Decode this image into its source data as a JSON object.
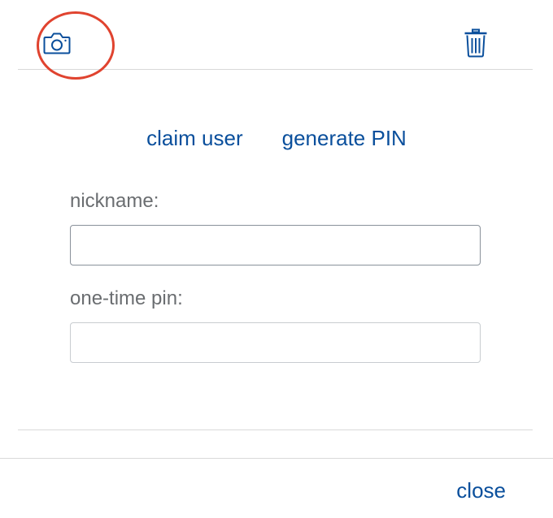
{
  "theme": {
    "accent": "#0a4f9c",
    "highlight": "#e0432f"
  },
  "toolbar": {
    "camera_icon": "camera-icon",
    "trash_icon": "trash-icon"
  },
  "actions": {
    "claim_user_label": "claim user",
    "generate_pin_label": "generate PIN"
  },
  "form": {
    "nickname": {
      "label": "nickname:",
      "value": "",
      "placeholder": ""
    },
    "one_time_pin": {
      "label": "one-time pin:",
      "value": "",
      "placeholder": ""
    }
  },
  "footer": {
    "close_label": "close"
  }
}
